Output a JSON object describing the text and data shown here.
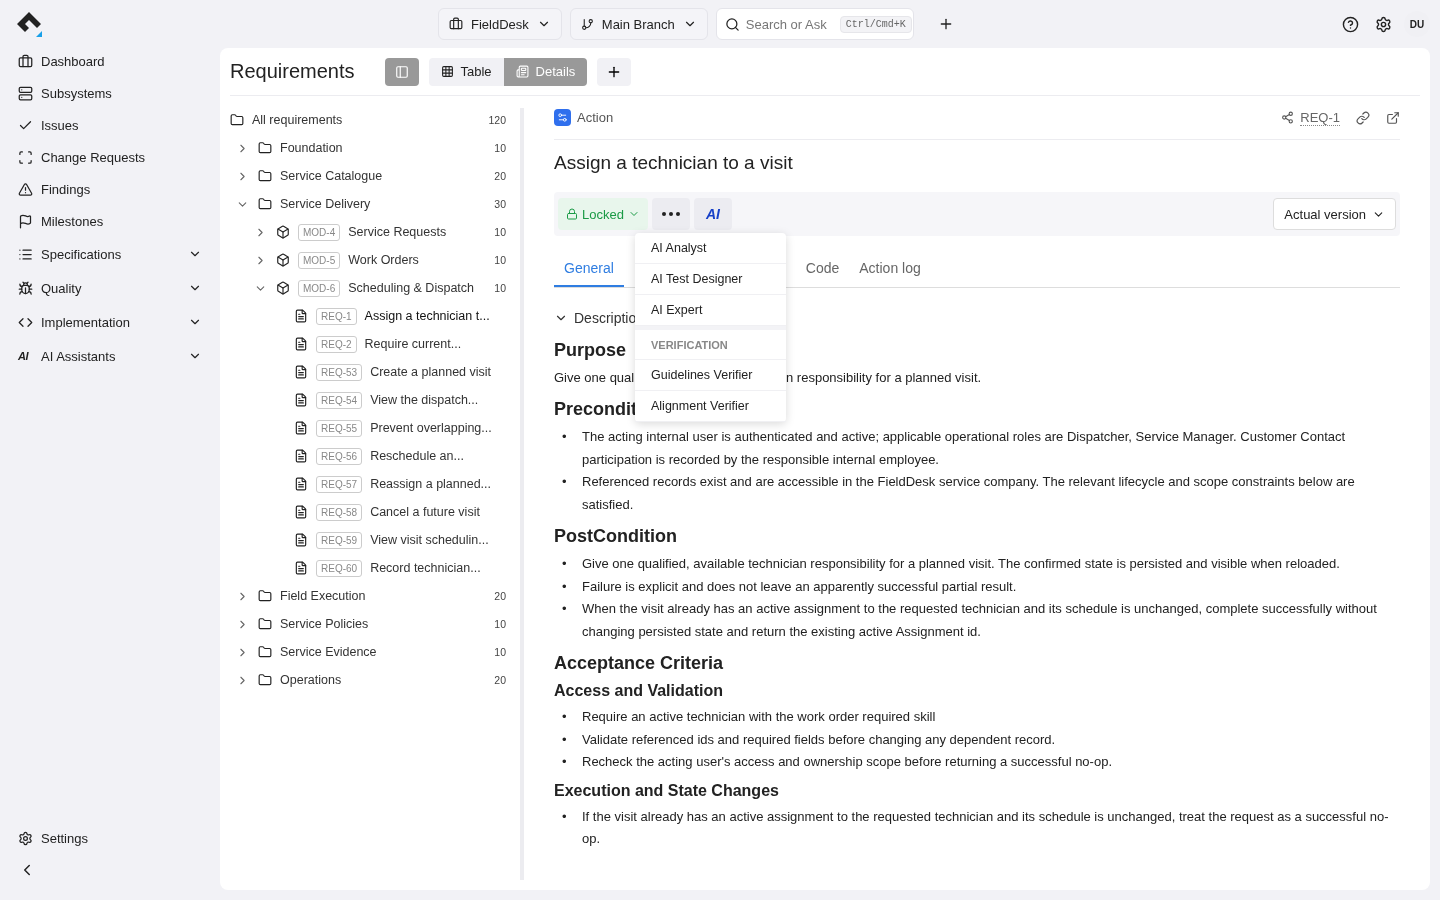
{
  "topbar": {
    "project": "FieldDesk",
    "branch": "Main Branch",
    "search": {
      "placeholder": "Search or Ask",
      "shortcut": "Ctrl/Cmd+K"
    },
    "avatar": "DU"
  },
  "sidebar": {
    "items": [
      {
        "label": "Dashboard",
        "has_chevron": false
      },
      {
        "label": "Subsystems",
        "has_chevron": false
      },
      {
        "label": "Issues",
        "has_chevron": false
      },
      {
        "label": "Change Requests",
        "has_chevron": false
      },
      {
        "label": "Findings",
        "has_chevron": false
      },
      {
        "label": "Milestones",
        "has_chevron": false
      },
      {
        "label": "Specifications",
        "has_chevron": true
      },
      {
        "label": "Quality",
        "has_chevron": true
      },
      {
        "label": "Implementation",
        "has_chevron": true
      },
      {
        "label": "AI Assistants",
        "icon_text": "AI",
        "has_chevron": true
      }
    ],
    "settings": "Settings"
  },
  "header": {
    "title": "Requirements",
    "panel_toggle_on": true,
    "views": [
      {
        "label": "Table",
        "selected": false
      },
      {
        "label": "Details",
        "selected": true
      }
    ]
  },
  "tree": {
    "root": {
      "label": "All requirements",
      "count": "120"
    },
    "items": [
      {
        "kind": "folder",
        "label": "Foundation",
        "count": "10",
        "expanded": false
      },
      {
        "kind": "folder",
        "label": "Service Catalogue",
        "count": "20",
        "expanded": false
      },
      {
        "kind": "folder",
        "label": "Service Delivery",
        "count": "30",
        "expanded": true,
        "children": [
          {
            "kind": "module",
            "id": "MOD-4",
            "label": "Service Requests",
            "count": "10",
            "expanded": false
          },
          {
            "kind": "module",
            "id": "MOD-5",
            "label": "Work Orders",
            "count": "10",
            "expanded": false
          },
          {
            "kind": "module",
            "id": "MOD-6",
            "label": "Scheduling & Dispatch",
            "count": "10",
            "expanded": true,
            "children": [
              {
                "kind": "req",
                "id": "REQ-1",
                "label": "Assign a technician t...",
                "selected": true
              },
              {
                "kind": "req",
                "id": "REQ-2",
                "label": "Require current...",
                "selected": false
              },
              {
                "kind": "req",
                "id": "REQ-53",
                "label": "Create a planned visit",
                "selected": false
              },
              {
                "kind": "req",
                "id": "REQ-54",
                "label": "View the dispatch...",
                "selected": false
              },
              {
                "kind": "req",
                "id": "REQ-55",
                "label": "Prevent overlapping...",
                "selected": false
              },
              {
                "kind": "req",
                "id": "REQ-56",
                "label": "Reschedule an...",
                "selected": false
              },
              {
                "kind": "req",
                "id": "REQ-57",
                "label": "Reassign a planned...",
                "selected": false
              },
              {
                "kind": "req",
                "id": "REQ-58",
                "label": "Cancel a future visit",
                "selected": false
              },
              {
                "kind": "req",
                "id": "REQ-59",
                "label": "View visit schedulin...",
                "selected": false
              },
              {
                "kind": "req",
                "id": "REQ-60",
                "label": "Record technician...",
                "selected": false
              }
            ]
          }
        ]
      },
      {
        "kind": "folder",
        "label": "Field Execution",
        "count": "20",
        "expanded": false
      },
      {
        "kind": "folder",
        "label": "Service Policies",
        "count": "10",
        "expanded": false
      },
      {
        "kind": "folder",
        "label": "Service Evidence",
        "count": "10",
        "expanded": false
      },
      {
        "kind": "folder",
        "label": "Operations",
        "count": "20",
        "expanded": false
      }
    ]
  },
  "detail": {
    "type": "Action",
    "ref": "REQ-1",
    "title": "Assign a technician to a visit",
    "status": "Locked",
    "ai_button": "AI",
    "version": "Actual version",
    "tabs": [
      {
        "label": "General",
        "selected": true
      },
      {
        "label": "Code",
        "selected": false
      },
      {
        "label": "Action log",
        "selected": false
      }
    ],
    "menu": [
      {
        "kind": "item",
        "label": "AI Analyst"
      },
      {
        "kind": "item",
        "label": "AI Test Designer"
      },
      {
        "kind": "item",
        "label": "AI Expert"
      },
      {
        "kind": "section",
        "label": "VERIFICATION"
      },
      {
        "kind": "item",
        "label": "Guidelines Verifier"
      },
      {
        "kind": "item",
        "label": "Alignment Verifier"
      }
    ],
    "description_label": "Descriptio",
    "purpose": {
      "heading": "Purpose",
      "text_before": "Give one qual",
      "text_after": "n responsibility for a planned visit."
    },
    "sections": [
      {
        "kind": "h2",
        "text": "Precondit"
      },
      {
        "kind": "bullets",
        "marker": "•",
        "items": [
          "The acting internal user is authenticated and active; applicable operational roles are Dispatcher, Service Manager. Customer Contact participation is recorded by the responsible internal employee.",
          "Referenced records exist and are accessible in the FieldDesk service company. The relevant lifecycle and scope constraints below are satisfied."
        ]
      },
      {
        "kind": "h2",
        "text": "PostCondition"
      },
      {
        "kind": "bullets",
        "marker": "•",
        "items": [
          "Give one qualified, available technician responsibility for a planned visit. The confirmed state is persisted and visible when reloaded.",
          "Failure is explicit and does not leave an apparently successful partial result.",
          "When the visit already has an active assignment to the requested technician and its schedule is unchanged, complete successfully without changing persisted state and return the existing active Assignment id."
        ]
      },
      {
        "kind": "h2",
        "text": "Acceptance Criteria"
      },
      {
        "kind": "h3",
        "text": "Access and Validation"
      },
      {
        "kind": "bullets",
        "marker": "•",
        "items": [
          "Require an active technician with the work order required skill",
          "Validate referenced ids and required fields before changing any dependent record.",
          "Recheck the acting user's access and ownership scope before returning a successful no-op."
        ]
      },
      {
        "kind": "h3",
        "text": "Execution and State Changes"
      },
      {
        "kind": "bullets",
        "marker": "•",
        "items": [
          "If the visit already has an active assignment to the requested technician and its schedule is unchanged, treat the request as a successful no-op."
        ]
      }
    ]
  }
}
